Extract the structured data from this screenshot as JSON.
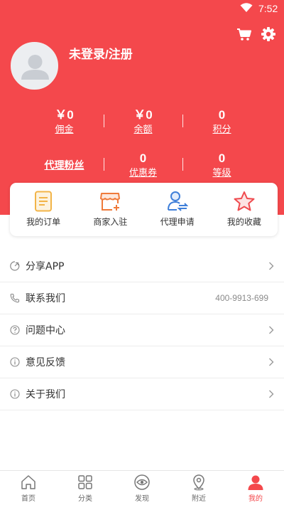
{
  "status_bar": {
    "time": "7:52"
  },
  "profile": {
    "login_text": "未登录/注册"
  },
  "stats": [
    {
      "value": "￥0",
      "label": "佣金"
    },
    {
      "value": "￥0",
      "label": "余额"
    },
    {
      "value": "0",
      "label": "积分"
    },
    {
      "value": "",
      "label": "代理粉丝"
    },
    {
      "value": "0",
      "label": "优惠券"
    },
    {
      "value": "0",
      "label": "等级"
    }
  ],
  "quick_actions": [
    {
      "label": "我的订单",
      "icon": "order-icon"
    },
    {
      "label": "商家入驻",
      "icon": "shop-icon"
    },
    {
      "label": "代理申请",
      "icon": "agent-icon"
    },
    {
      "label": "我的收藏",
      "icon": "star-icon"
    }
  ],
  "menu": [
    {
      "label": "分享APP",
      "icon": "share-icon"
    },
    {
      "label": "联系我们",
      "icon": "phone-icon",
      "value": "400-9913-699"
    },
    {
      "label": "问题中心",
      "icon": "question-icon"
    },
    {
      "label": "意见反馈",
      "icon": "info-icon"
    },
    {
      "label": "关于我们",
      "icon": "info-icon"
    }
  ],
  "tabs": [
    {
      "label": "首页",
      "icon": "home-icon"
    },
    {
      "label": "分类",
      "icon": "category-icon"
    },
    {
      "label": "发现",
      "icon": "discover-icon"
    },
    {
      "label": "附近",
      "icon": "location-icon"
    },
    {
      "label": "我的",
      "icon": "user-icon",
      "active": true
    }
  ],
  "colors": {
    "brand": "#f4484c",
    "order": "#f2b448",
    "shop": "#ef7a3a",
    "agent": "#3f7fd9",
    "favorite": "#ef4a4e"
  }
}
